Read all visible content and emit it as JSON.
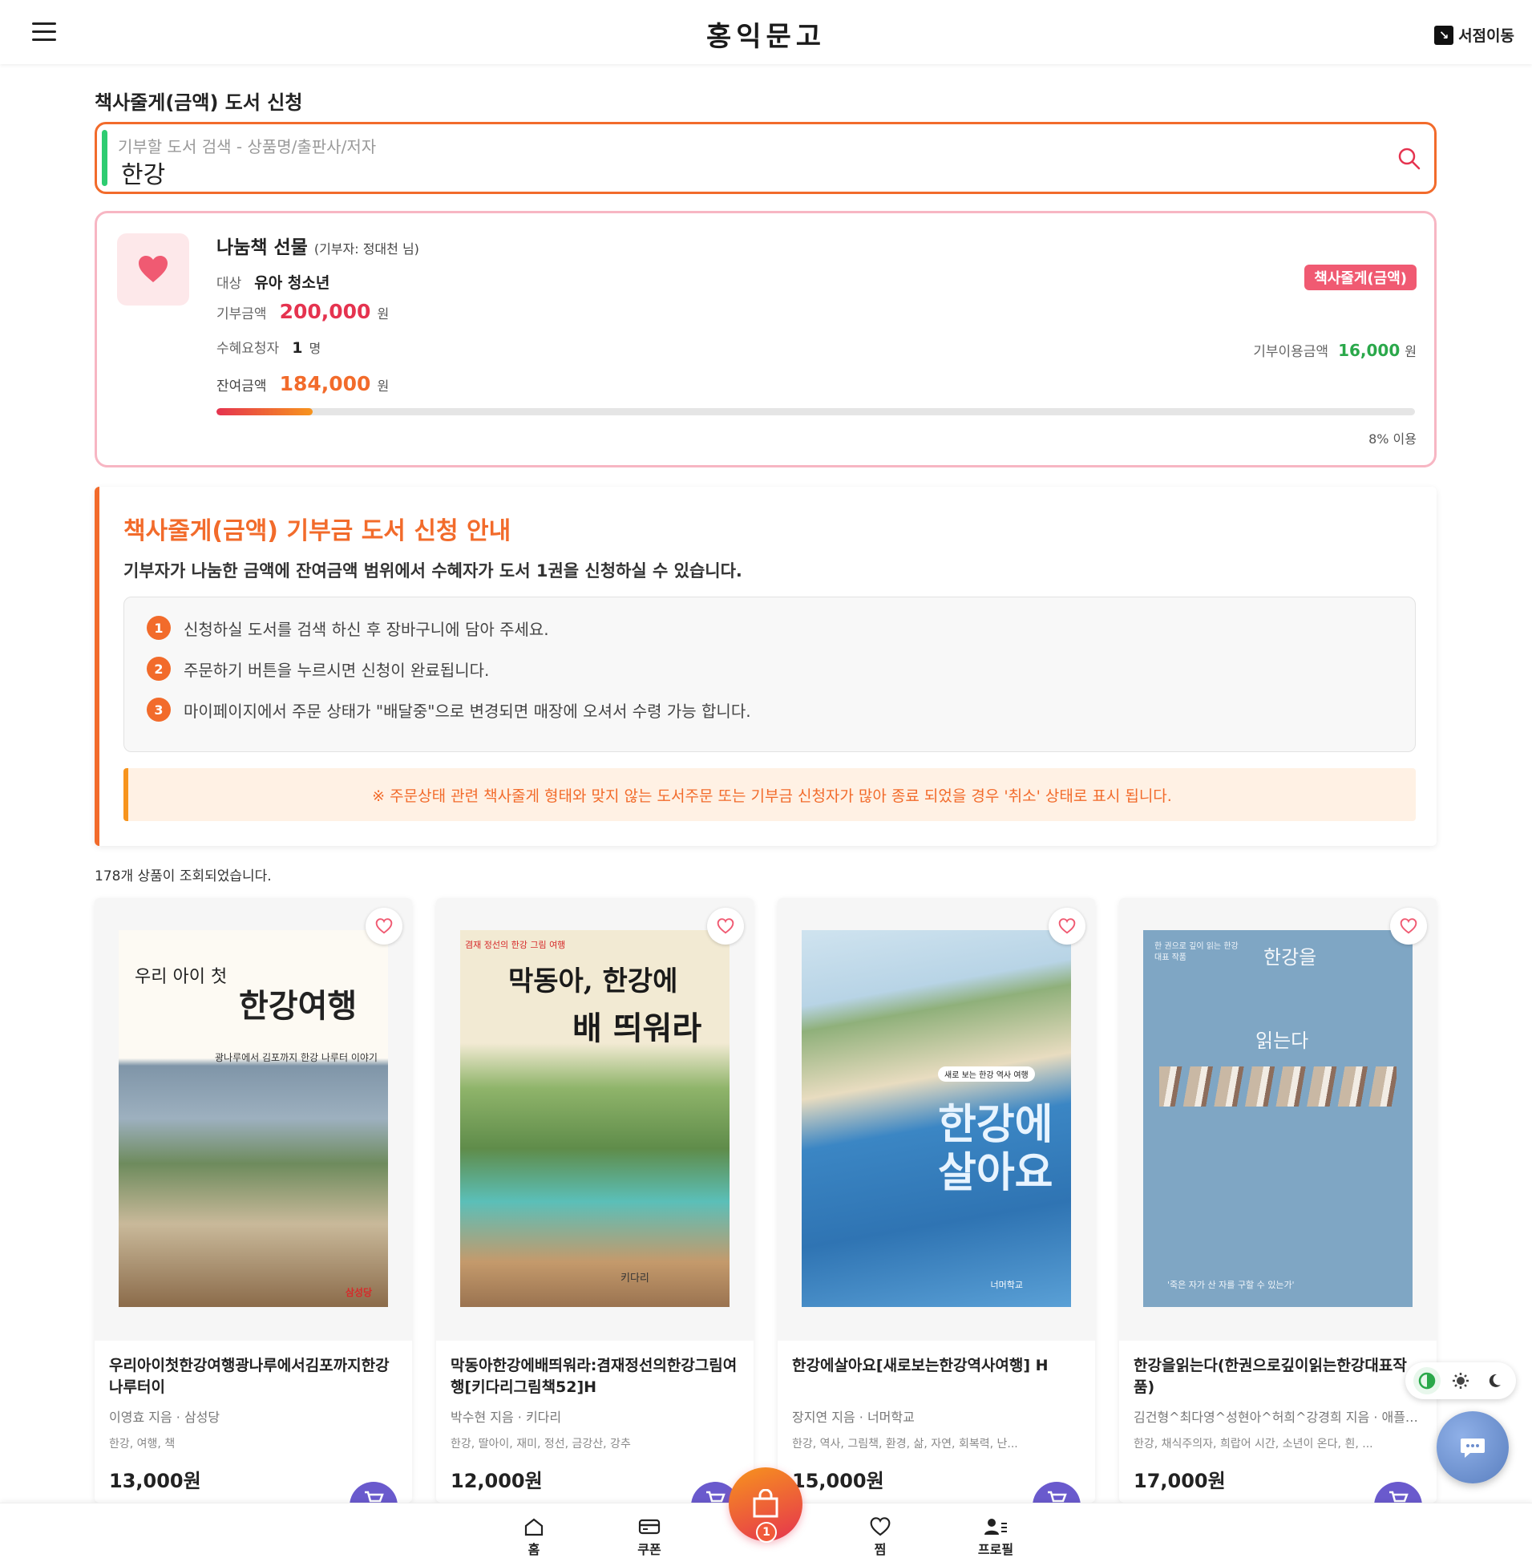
{
  "header": {
    "logo": "홍익문고",
    "store_move_label": "서점이동"
  },
  "page": {
    "title": "책사줄게(금액) 도서 신청"
  },
  "search": {
    "placeholder": "기부할 도서 검색 - 상품명/출판사/저자",
    "value": "한강"
  },
  "gift": {
    "title": "나눔책 선물",
    "donor": "(기부자: 정대천 님)",
    "target_label": "대상",
    "target_value": "유아 청소년",
    "badge": "책사줄게(금액)",
    "donation_label": "기부금액",
    "donation_value": "200,000",
    "donation_unit": "원",
    "requesters_label": "수혜요청자",
    "requesters_value": "1",
    "requesters_unit": "명",
    "used_label": "기부이용금액",
    "used_value": "16,000",
    "used_unit": "원",
    "remaining_label": "잔여금액",
    "remaining_value": "184,000",
    "remaining_unit": "원",
    "usage_percent": 8,
    "usage_text": "8% 이용"
  },
  "guide": {
    "title": "책사줄게(금액) 기부금 도서 신청 안내",
    "description": "기부자가 나눔한 금액에 잔여금액 범위에서 수혜자가 도서 1권을 신청하실 수 있습니다.",
    "steps": [
      {
        "num": "1",
        "text": "신청하실 도서를 검색 하신 후 장바구니에 담아 주세요."
      },
      {
        "num": "2",
        "text": "주문하기 버튼을 누르시면 신청이 완료됩니다."
      },
      {
        "num": "3",
        "text": "마이페이지에서 주문 상태가 \"배달중\"으로 변경되면 매장에 오셔서 수령 가능 합니다."
      }
    ],
    "notice": "※ 주문상태 관련 책사줄게 형태와 맞지 않는 도서주문 또는 기부금 신청자가 많아 종료 되었을 경우 '취소' 상태로 표시 됩니다."
  },
  "results": {
    "count_text": "178개 상품이 조회되었습니다."
  },
  "products": [
    {
      "name": "우리아이첫한강여행광나루에서김포까지한강나루터이",
      "author": "이영효 지음 · 삼성당",
      "tags": "한강, 여행, 책",
      "price": "13,000원",
      "cover": {
        "line1": "우리 아이 첫",
        "line2": "한강여행",
        "sub": "광나루에서 김포까지 한강 나루터 이야기",
        "publisher": "삼성당"
      }
    },
    {
      "name": "막동아한강에배띄워라:겸재정선의한강그림여행[키다리그림책52]H",
      "author": "박수현 지음 · 키다리",
      "tags": "한강, 딸아이, 재미, 정선, 금강산, 강추",
      "price": "12,000원",
      "cover": {
        "line1": "막동아, 한강에",
        "line2": "배 띄워라",
        "sub": "겸재 정선의 한강 그림 여행",
        "publisher": "키다리"
      }
    },
    {
      "name": "한강에살아요[새로보는한강역사여행] H",
      "author": "장지연 지음 · 너머학교",
      "tags": "한강, 역사, 그림책, 환경, 삶, 자연, 회복력, 난...",
      "price": "15,000원",
      "cover": {
        "line1": "한강에",
        "line2": "살아요",
        "sub": "새로 보는 한강 역사 여행",
        "publisher": "너머학교"
      }
    },
    {
      "name": "한강을읽는다(한권으로깊이읽는한강대표작품)",
      "author": "김건형^최다영^성현아^허희^강경희 지음 · 애플…",
      "tags": "한강, 채식주의자, 희랍어 시간, 소년이 온다, 흰, ...",
      "price": "17,000원",
      "cover": {
        "line1": "한강을",
        "line2": "읽는다",
        "sub": "한 권으로 깊이 읽는 한강 대표 작품",
        "publisher": "'죽은 자가 산 자를 구할 수 있는가'"
      }
    }
  ],
  "bottom_nav": {
    "home": "홈",
    "coupon": "쿠폰",
    "cart_count": "1",
    "wish": "찜",
    "profile": "프로필"
  },
  "colors": {
    "accent_orange": "#f26b2b",
    "accent_pink": "#f05a72",
    "accent_green": "#2aa84a",
    "cart_purple": "#6a5acd"
  }
}
